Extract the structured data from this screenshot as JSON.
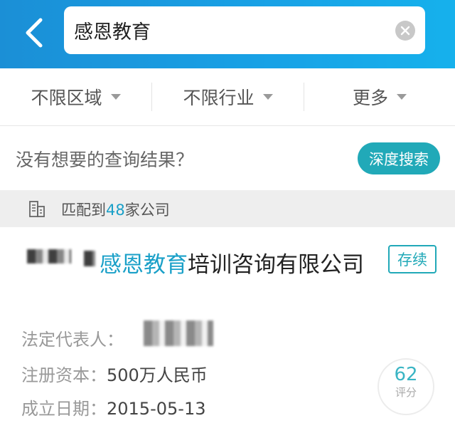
{
  "search": {
    "query": "感恩教育"
  },
  "filters": [
    {
      "label": "不限区域"
    },
    {
      "label": "不限行业"
    },
    {
      "label": "更多"
    }
  ],
  "no_result": {
    "text": "没有想要的查询结果？",
    "deep_search_label": "深度搜索"
  },
  "match": {
    "prefix": "匹配到",
    "count": "48",
    "suffix": "家公司"
  },
  "result": {
    "name_highlight": "感恩教育",
    "name_rest": "培训咨询有限公司",
    "status": "存续",
    "legal_rep_label": "法定代表人：",
    "capital_label": "注册资本：",
    "capital_value": "500万人民币",
    "founded_label": "成立日期：",
    "founded_value": "2015-05-13",
    "score": "62",
    "score_label": "评分"
  },
  "colors": {
    "header": "#18a2e6",
    "accent": "#21a9b8",
    "highlight": "#1aa0c8"
  }
}
